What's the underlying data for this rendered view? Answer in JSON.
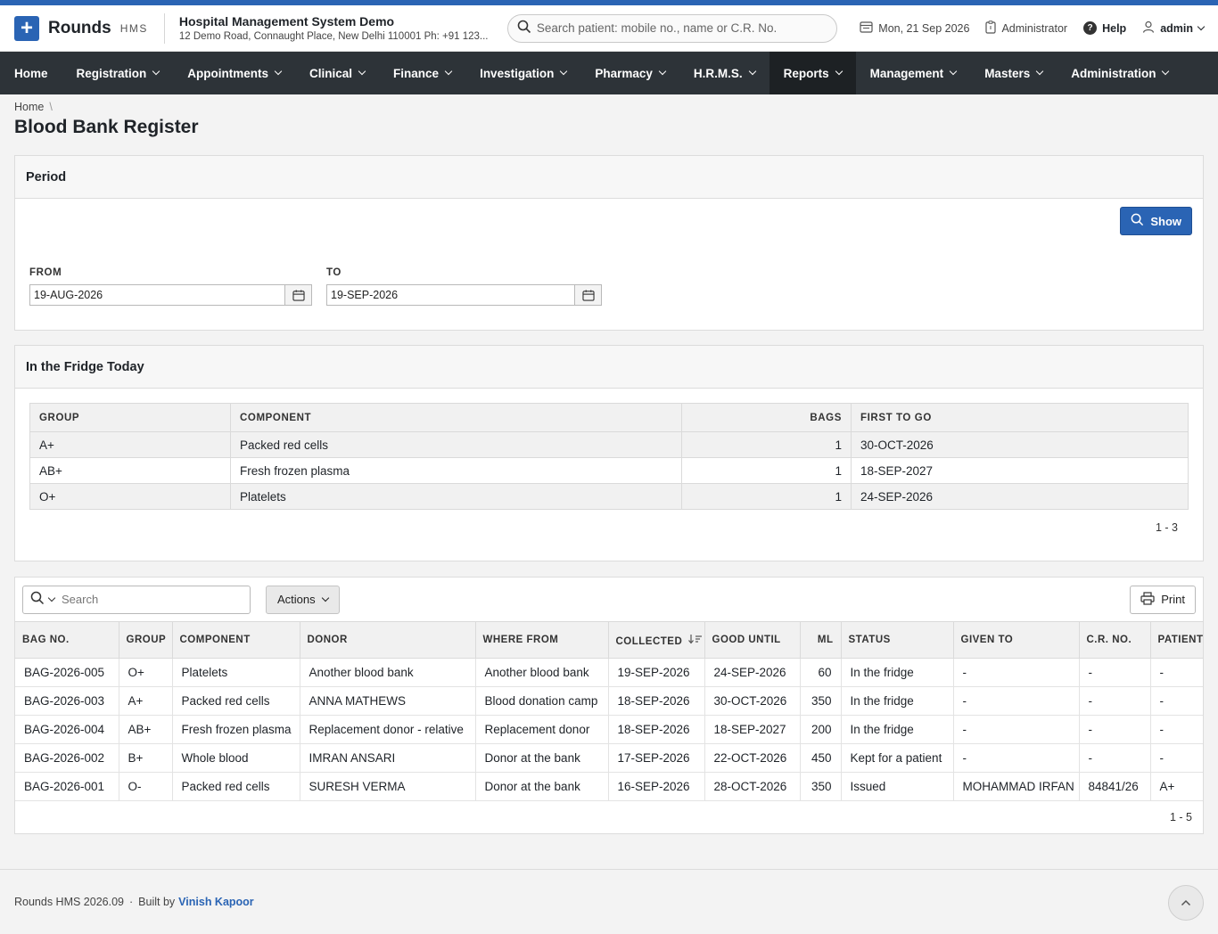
{
  "header": {
    "brand": "Rounds",
    "brand_sub": "HMS",
    "hospital_name": "Hospital Management System Demo",
    "hospital_address": "12 Demo Road, Connaught Place, New Delhi 110001 Ph: +91 123...",
    "search_placeholder": "Search patient: mobile no., name or C.R. No.",
    "date": "Mon, 21 Sep 2026",
    "role": "Administrator",
    "help": "Help",
    "user": "admin"
  },
  "nav": {
    "items": [
      {
        "label": "Home"
      },
      {
        "label": "Registration"
      },
      {
        "label": "Appointments"
      },
      {
        "label": "Clinical"
      },
      {
        "label": "Finance"
      },
      {
        "label": "Investigation"
      },
      {
        "label": "Pharmacy"
      },
      {
        "label": "H.R.M.S."
      },
      {
        "label": "Reports"
      },
      {
        "label": "Management"
      },
      {
        "label": "Masters"
      },
      {
        "label": "Administration"
      }
    ],
    "active": "Reports"
  },
  "breadcrumb": {
    "home": "Home"
  },
  "page_title": "Blood Bank Register",
  "period": {
    "title": "Period",
    "show_label": "Show",
    "from_label": "FROM",
    "from_value": "19-AUG-2026",
    "to_label": "TO",
    "to_value": "19-SEP-2026"
  },
  "fridge": {
    "title": "In the Fridge Today",
    "columns": [
      "GROUP",
      "COMPONENT",
      "BAGS",
      "FIRST TO GO"
    ],
    "rows": [
      [
        "A+",
        "Packed red cells",
        "1",
        "30-OCT-2026"
      ],
      [
        "AB+",
        "Fresh frozen plasma",
        "1",
        "18-SEP-2027"
      ],
      [
        "O+",
        "Platelets",
        "1",
        "24-SEP-2026"
      ]
    ],
    "pager": "1 - 3"
  },
  "register": {
    "search_placeholder": "Search",
    "actions_label": "Actions",
    "print_label": "Print",
    "columns": [
      "BAG NO.",
      "GROUP",
      "COMPONENT",
      "DONOR",
      "WHERE FROM",
      "COLLECTED",
      "GOOD UNTIL",
      "ML",
      "STATUS",
      "GIVEN TO",
      "C.R. NO.",
      "PATIENT"
    ],
    "rows": [
      [
        "BAG-2026-005",
        "O+",
        "Platelets",
        "Another blood bank",
        "Another blood bank",
        "19-SEP-2026",
        "24-SEP-2026",
        "60",
        "In the fridge",
        "-",
        "-",
        "-"
      ],
      [
        "BAG-2026-003",
        "A+",
        "Packed red cells",
        "ANNA MATHEWS",
        "Blood donation camp",
        "18-SEP-2026",
        "30-OCT-2026",
        "350",
        "In the fridge",
        "-",
        "-",
        "-"
      ],
      [
        "BAG-2026-004",
        "AB+",
        "Fresh frozen plasma",
        "Replacement donor - relative",
        "Replacement donor",
        "18-SEP-2026",
        "18-SEP-2027",
        "200",
        "In the fridge",
        "-",
        "-",
        "-"
      ],
      [
        "BAG-2026-002",
        "B+",
        "Whole blood",
        "IMRAN ANSARI",
        "Donor at the bank",
        "17-SEP-2026",
        "22-OCT-2026",
        "450",
        "Kept for a patient",
        "-",
        "-",
        "-"
      ],
      [
        "BAG-2026-001",
        "O-",
        "Packed red cells",
        "SURESH VERMA",
        "Donor at the bank",
        "16-SEP-2026",
        "28-OCT-2026",
        "350",
        "Issued",
        "MOHAMMAD IRFAN",
        "84841/26",
        "A+"
      ]
    ],
    "pager": "1 - 5"
  },
  "footer": {
    "version": "Rounds HMS 2026.09",
    "built_by": "Built by",
    "author": "Vinish Kapoor"
  },
  "colors": {
    "accent": "#2a64b4",
    "nav_bg": "#2d3338",
    "nav_active": "#1d2124"
  }
}
